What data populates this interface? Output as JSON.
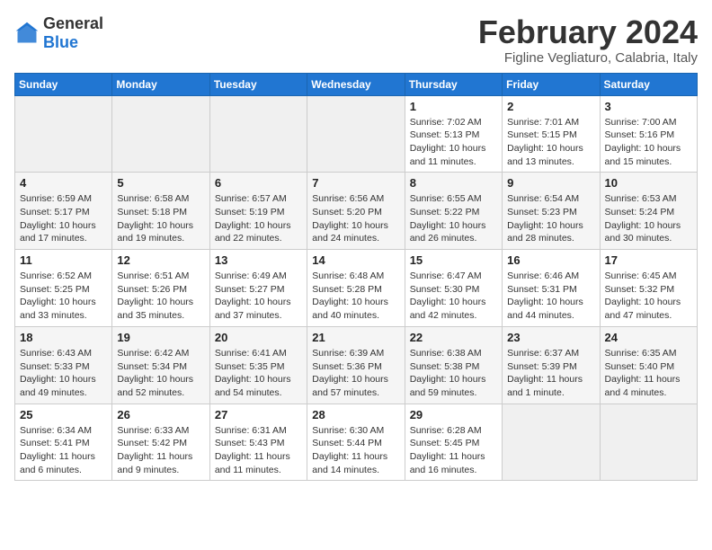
{
  "header": {
    "logo": {
      "text_general": "General",
      "text_blue": "Blue"
    },
    "title": "February 2024",
    "location": "Figline Vegliaturo, Calabria, Italy"
  },
  "weekdays": [
    "Sunday",
    "Monday",
    "Tuesday",
    "Wednesday",
    "Thursday",
    "Friday",
    "Saturday"
  ],
  "weeks": [
    [
      {
        "day": "",
        "info": ""
      },
      {
        "day": "",
        "info": ""
      },
      {
        "day": "",
        "info": ""
      },
      {
        "day": "",
        "info": ""
      },
      {
        "day": "1",
        "info": "Sunrise: 7:02 AM\nSunset: 5:13 PM\nDaylight: 10 hours\nand 11 minutes."
      },
      {
        "day": "2",
        "info": "Sunrise: 7:01 AM\nSunset: 5:15 PM\nDaylight: 10 hours\nand 13 minutes."
      },
      {
        "day": "3",
        "info": "Sunrise: 7:00 AM\nSunset: 5:16 PM\nDaylight: 10 hours\nand 15 minutes."
      }
    ],
    [
      {
        "day": "4",
        "info": "Sunrise: 6:59 AM\nSunset: 5:17 PM\nDaylight: 10 hours\nand 17 minutes."
      },
      {
        "day": "5",
        "info": "Sunrise: 6:58 AM\nSunset: 5:18 PM\nDaylight: 10 hours\nand 19 minutes."
      },
      {
        "day": "6",
        "info": "Sunrise: 6:57 AM\nSunset: 5:19 PM\nDaylight: 10 hours\nand 22 minutes."
      },
      {
        "day": "7",
        "info": "Sunrise: 6:56 AM\nSunset: 5:20 PM\nDaylight: 10 hours\nand 24 minutes."
      },
      {
        "day": "8",
        "info": "Sunrise: 6:55 AM\nSunset: 5:22 PM\nDaylight: 10 hours\nand 26 minutes."
      },
      {
        "day": "9",
        "info": "Sunrise: 6:54 AM\nSunset: 5:23 PM\nDaylight: 10 hours\nand 28 minutes."
      },
      {
        "day": "10",
        "info": "Sunrise: 6:53 AM\nSunset: 5:24 PM\nDaylight: 10 hours\nand 30 minutes."
      }
    ],
    [
      {
        "day": "11",
        "info": "Sunrise: 6:52 AM\nSunset: 5:25 PM\nDaylight: 10 hours\nand 33 minutes."
      },
      {
        "day": "12",
        "info": "Sunrise: 6:51 AM\nSunset: 5:26 PM\nDaylight: 10 hours\nand 35 minutes."
      },
      {
        "day": "13",
        "info": "Sunrise: 6:49 AM\nSunset: 5:27 PM\nDaylight: 10 hours\nand 37 minutes."
      },
      {
        "day": "14",
        "info": "Sunrise: 6:48 AM\nSunset: 5:28 PM\nDaylight: 10 hours\nand 40 minutes."
      },
      {
        "day": "15",
        "info": "Sunrise: 6:47 AM\nSunset: 5:30 PM\nDaylight: 10 hours\nand 42 minutes."
      },
      {
        "day": "16",
        "info": "Sunrise: 6:46 AM\nSunset: 5:31 PM\nDaylight: 10 hours\nand 44 minutes."
      },
      {
        "day": "17",
        "info": "Sunrise: 6:45 AM\nSunset: 5:32 PM\nDaylight: 10 hours\nand 47 minutes."
      }
    ],
    [
      {
        "day": "18",
        "info": "Sunrise: 6:43 AM\nSunset: 5:33 PM\nDaylight: 10 hours\nand 49 minutes."
      },
      {
        "day": "19",
        "info": "Sunrise: 6:42 AM\nSunset: 5:34 PM\nDaylight: 10 hours\nand 52 minutes."
      },
      {
        "day": "20",
        "info": "Sunrise: 6:41 AM\nSunset: 5:35 PM\nDaylight: 10 hours\nand 54 minutes."
      },
      {
        "day": "21",
        "info": "Sunrise: 6:39 AM\nSunset: 5:36 PM\nDaylight: 10 hours\nand 57 minutes."
      },
      {
        "day": "22",
        "info": "Sunrise: 6:38 AM\nSunset: 5:38 PM\nDaylight: 10 hours\nand 59 minutes."
      },
      {
        "day": "23",
        "info": "Sunrise: 6:37 AM\nSunset: 5:39 PM\nDaylight: 11 hours\nand 1 minute."
      },
      {
        "day": "24",
        "info": "Sunrise: 6:35 AM\nSunset: 5:40 PM\nDaylight: 11 hours\nand 4 minutes."
      }
    ],
    [
      {
        "day": "25",
        "info": "Sunrise: 6:34 AM\nSunset: 5:41 PM\nDaylight: 11 hours\nand 6 minutes."
      },
      {
        "day": "26",
        "info": "Sunrise: 6:33 AM\nSunset: 5:42 PM\nDaylight: 11 hours\nand 9 minutes."
      },
      {
        "day": "27",
        "info": "Sunrise: 6:31 AM\nSunset: 5:43 PM\nDaylight: 11 hours\nand 11 minutes."
      },
      {
        "day": "28",
        "info": "Sunrise: 6:30 AM\nSunset: 5:44 PM\nDaylight: 11 hours\nand 14 minutes."
      },
      {
        "day": "29",
        "info": "Sunrise: 6:28 AM\nSunset: 5:45 PM\nDaylight: 11 hours\nand 16 minutes."
      },
      {
        "day": "",
        "info": ""
      },
      {
        "day": "",
        "info": ""
      }
    ]
  ]
}
